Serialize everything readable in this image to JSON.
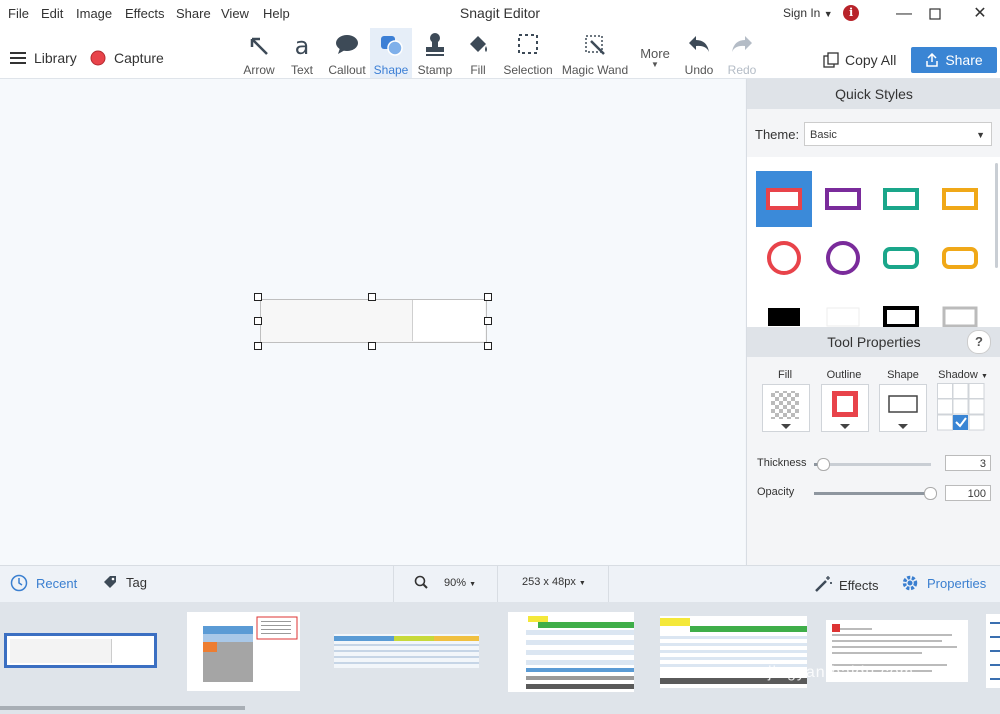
{
  "menu": [
    "File",
    "Edit",
    "Image",
    "Effects",
    "Share",
    "View",
    "Help"
  ],
  "app_title": "Snagit Editor",
  "sign_in": "Sign In",
  "toolbar": {
    "library": "Library",
    "capture": "Capture",
    "tools": [
      {
        "label": "Arrow",
        "icon": "arrow-icon"
      },
      {
        "label": "Text",
        "icon": "text-icon"
      },
      {
        "label": "Callout",
        "icon": "callout-icon"
      },
      {
        "label": "Shape",
        "icon": "shape-icon"
      },
      {
        "label": "Stamp",
        "icon": "stamp-icon"
      },
      {
        "label": "Fill",
        "icon": "fill-icon"
      },
      {
        "label": "Selection",
        "icon": "selection-icon"
      },
      {
        "label": "Magic Wand",
        "icon": "magic-wand-icon"
      },
      {
        "label": "More",
        "icon": "chevron-down-icon"
      },
      {
        "label": "Undo",
        "icon": "undo-icon"
      },
      {
        "label": "Redo",
        "icon": "redo-icon"
      }
    ],
    "active_tool": "Shape",
    "copy_all": "Copy All",
    "share": "Share"
  },
  "quick_styles": {
    "title": "Quick Styles",
    "theme_label": "Theme:",
    "theme_value": "Basic",
    "styles": [
      {
        "shape": "rect",
        "color": "#e8434a",
        "selected": true
      },
      {
        "shape": "rect",
        "color": "#7a2b9b"
      },
      {
        "shape": "rect",
        "color": "#1aa68a"
      },
      {
        "shape": "rect",
        "color": "#f0a818"
      },
      {
        "shape": "circle",
        "color": "#e8434a"
      },
      {
        "shape": "circle",
        "color": "#7a2b9b"
      },
      {
        "shape": "rounded",
        "color": "#1aa68a"
      },
      {
        "shape": "rounded",
        "color": "#f0a818"
      },
      {
        "shape": "filled",
        "color": "#000000"
      },
      {
        "shape": "filled",
        "color": "#ffffff"
      },
      {
        "shape": "thick",
        "color": "#000000"
      },
      {
        "shape": "thick",
        "color": "#ffffff"
      }
    ]
  },
  "tool_properties": {
    "title": "Tool Properties",
    "help": "?",
    "fill_label": "Fill",
    "outline_label": "Outline",
    "shape_label": "Shape",
    "shadow_label": "Shadow",
    "outline_color": "#e8434a",
    "thickness_label": "Thickness",
    "thickness_value": "3",
    "opacity_label": "Opacity",
    "opacity_value": "100"
  },
  "status_bar": {
    "recent": "Recent",
    "tag": "Tag",
    "zoom": "90%",
    "dimensions": "253 x 48px",
    "effects": "Effects",
    "properties": "Properties"
  },
  "tray_watermark": "jingyan.baidu.com"
}
